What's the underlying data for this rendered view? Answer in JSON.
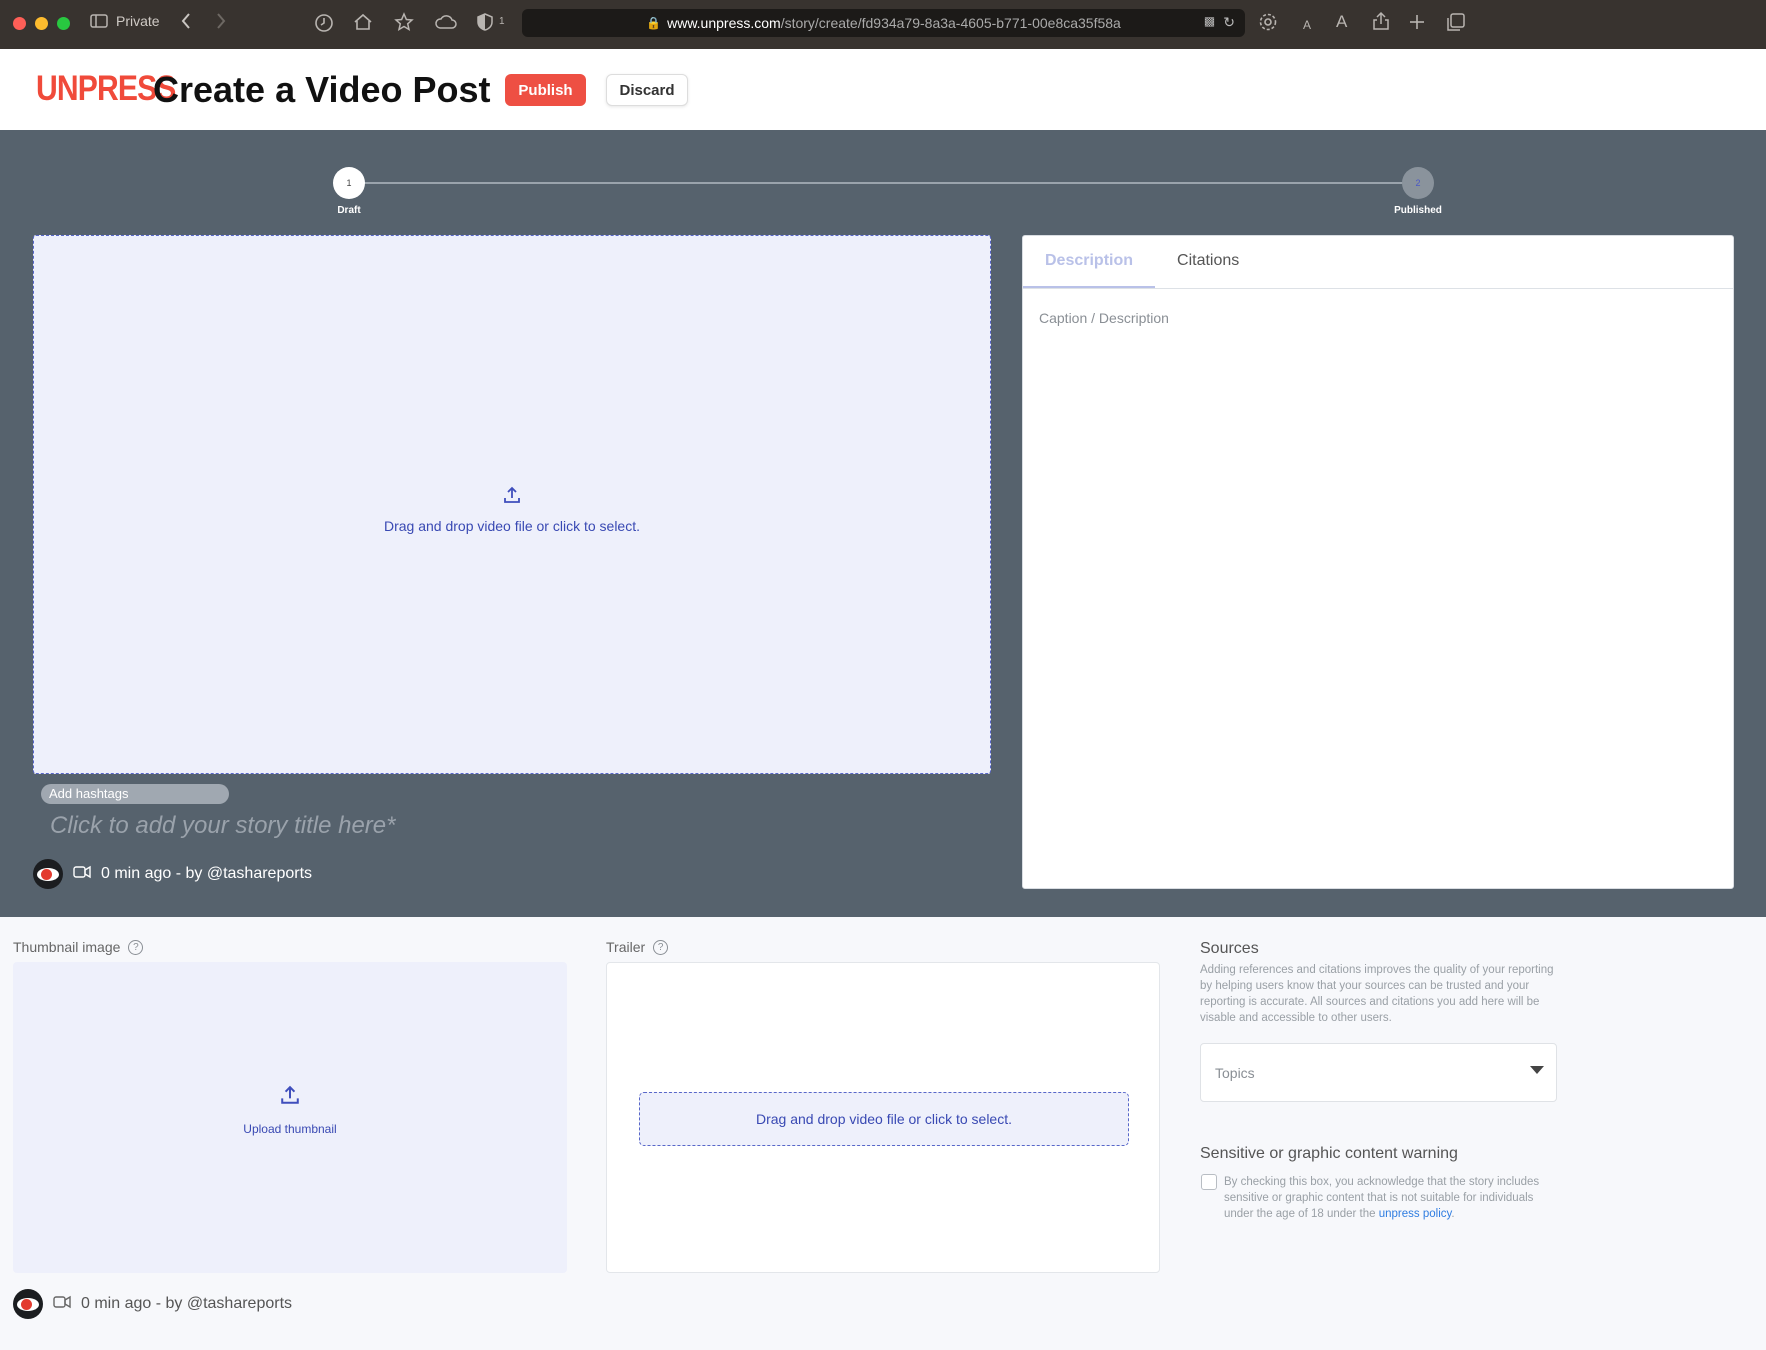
{
  "browser": {
    "window_label": "Private",
    "url_host": "www.unpress.com",
    "url_path": "/story/create/fd934a79-8a3a-4605-b771-00e8ca35f58a",
    "privacy_badge_count": "1",
    "small_text_label": "A",
    "large_text_label": "A"
  },
  "header": {
    "logo_text": "UNPRESS",
    "title": "Create a Video Post",
    "publish_label": "Publish",
    "discard_label": "Discard"
  },
  "stepper": {
    "steps": [
      {
        "number": "1",
        "label": "Draft"
      },
      {
        "number": "2",
        "label": "Published"
      }
    ]
  },
  "editor": {
    "video_drop_text": "Drag and drop video file or click to select.",
    "hashtags_label": "Add hashtags",
    "title_placeholder": "Click to add your story title here*",
    "meta_text": "0 min ago - by @tashareports"
  },
  "side_panel": {
    "tabs": [
      {
        "label": "Description",
        "active": true
      },
      {
        "label": "Citations",
        "active": false
      }
    ],
    "caption_placeholder": "Caption / Description"
  },
  "thumbnail": {
    "label": "Thumbnail image",
    "upload_text": "Upload thumbnail"
  },
  "trailer": {
    "label": "Trailer",
    "drop_text": "Drag and drop video file or click to select."
  },
  "sources": {
    "title": "Sources",
    "description": "Adding references and citations improves the quality of your reporting by helping users know that your sources can be trusted and your reporting is accurate. All sources and citations you add here will be visable and accessible to other users.",
    "topics_placeholder": "Topics"
  },
  "warning": {
    "title": "Sensitive or graphic content warning",
    "text": "By checking this box, you acknowledge that the story includes sensitive or graphic content that is not suitable for individuals under the age of 18 under the",
    "link_text": "unpress policy",
    "text_end": "."
  },
  "footer_meta": {
    "meta_text": "0 min ago - by @tashareports"
  },
  "colors": {
    "brand": "#f04a3a",
    "publish": "#ee4f43",
    "editor_bg": "#56626d",
    "dropzone_bg": "#eef0fb",
    "accent_text": "#3949b3",
    "link": "#2f7de1"
  }
}
